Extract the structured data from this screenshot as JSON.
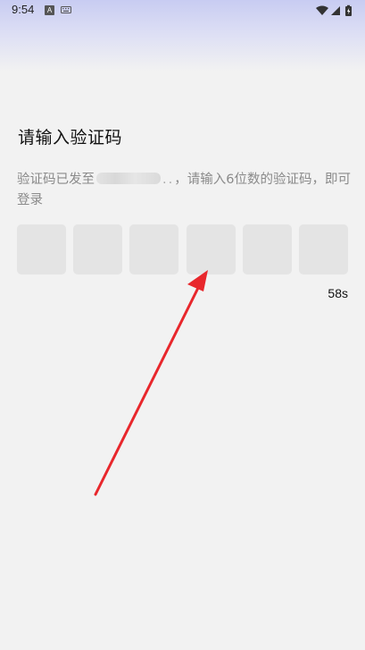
{
  "status_bar": {
    "time": "9:54",
    "icons": [
      "a-notification-icon",
      "keyboard-icon",
      "wifi-icon",
      "signal-icon",
      "battery-charging-icon"
    ]
  },
  "verify": {
    "title": "请输入验证码",
    "subtitle_prefix": "验证码已发至",
    "masked_dots": "..",
    "subtitle_suffix": "，请输入6位数的验证码，即可登录",
    "code_length": 6,
    "countdown": "58s"
  },
  "annotation": {
    "arrow_color": "#e8272c"
  }
}
